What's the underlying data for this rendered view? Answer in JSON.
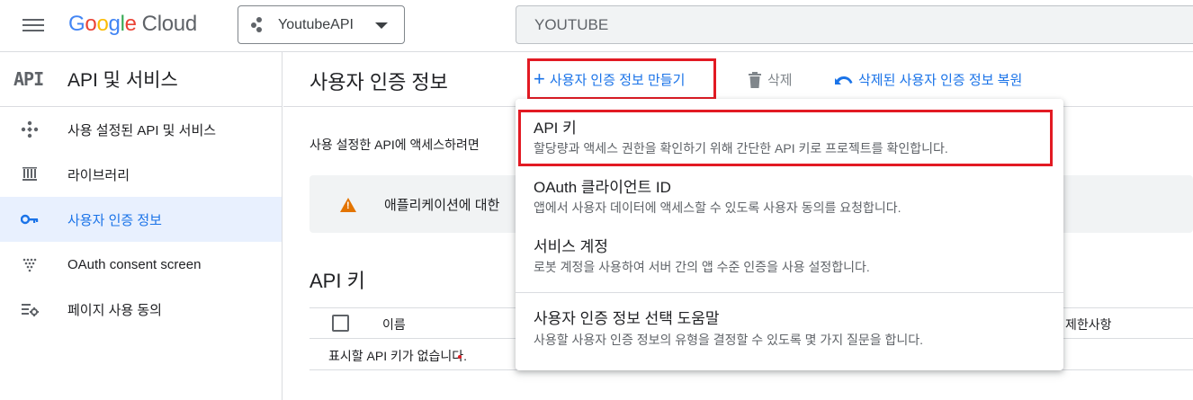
{
  "topbar": {
    "logo_google": "Google",
    "logo_cloud": "Cloud",
    "project_name": "YoutubeAPI",
    "search_value": "YOUTUBE"
  },
  "sidebar": {
    "badge": "API",
    "title": "API 및 서비스",
    "items": [
      {
        "label": "사용 설정된 API 및 서비스",
        "icon": "diamond-dots-icon"
      },
      {
        "label": "라이브러리",
        "icon": "library-icon"
      },
      {
        "label": "사용자 인증 정보",
        "icon": "key-icon",
        "active": true
      },
      {
        "label": "OAuth consent screen",
        "icon": "consent-icon"
      },
      {
        "label": "페이지 사용 동의",
        "icon": "settings-list-icon"
      }
    ]
  },
  "main": {
    "title": "사용자 인증 정보",
    "create_label": "사용자 인증 정보 만들기",
    "delete_label": "삭제",
    "restore_label": "삭제된 사용자 인증 정보 복원",
    "description": "사용 설정한 API에 액세스하려면",
    "warning": "애플리케이션에 대한",
    "section_title": "API 키",
    "col_name": "이름",
    "col_limit": "제한사항",
    "empty_text": "표시할 API 키가 없습니다."
  },
  "menu": {
    "items": [
      {
        "title": "API 키",
        "desc": "할당량과 액세스 권한을 확인하기 위해 간단한 API 키로 프로젝트를 확인합니다."
      },
      {
        "title": "OAuth 클라이언트 ID",
        "desc": "앱에서 사용자 데이터에 액세스할 수 있도록 사용자 동의를 요청합니다."
      },
      {
        "title": "서비스 계정",
        "desc": "로봇 계정을 사용하여 서버 간의 앱 수준 인증을 사용 설정합니다."
      },
      {
        "title": "사용자 인증 정보 선택 도움말",
        "desc": "사용할 사용자 인증 정보의 유형을 결정할 수 있도록 몇 가지 질문을 합니다."
      }
    ]
  },
  "colors": {
    "accent": "#1a73e8",
    "highlight": "#e21a23",
    "warning": "#e37400"
  }
}
